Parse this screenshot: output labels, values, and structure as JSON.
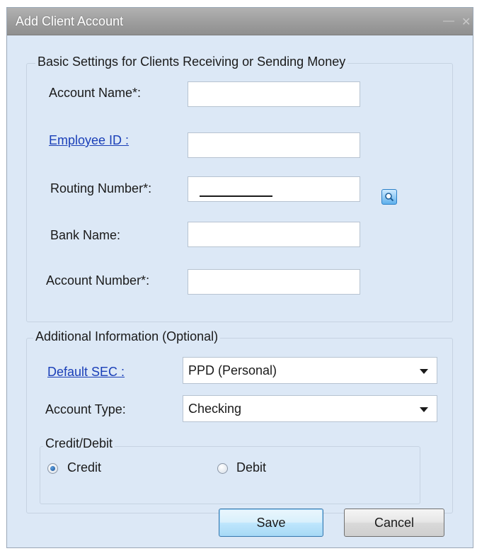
{
  "window": {
    "title": "Add Client Account",
    "minimize_glyph": "—",
    "close_glyph": "✕"
  },
  "basic_settings": {
    "legend": "Basic Settings for Clients Receiving or Sending Money",
    "account_name": {
      "label": "Account Name*:",
      "value": ""
    },
    "employee_id": {
      "label": "Employee ID :",
      "value": ""
    },
    "routing_number": {
      "label": "Routing Number*:",
      "value": ""
    },
    "bank_name": {
      "label": "Bank Name:",
      "value": ""
    },
    "account_number": {
      "label": "Account Number*:",
      "value": ""
    }
  },
  "additional_info": {
    "legend": "Additional Information (Optional)",
    "default_sec": {
      "label": "Default SEC :",
      "selected": "PPD (Personal)"
    },
    "account_type": {
      "label": "Account Type:",
      "selected": "Checking"
    },
    "credit_debit": {
      "legend": "Credit/Debit",
      "credit_label": "Credit",
      "debit_label": "Debit",
      "selected": "Credit"
    }
  },
  "buttons": {
    "save": "Save",
    "cancel": "Cancel"
  },
  "icons": {
    "lookup": "search-icon"
  },
  "colors": {
    "dialog_bg": "#dce8f6",
    "link": "#1a3fb8",
    "titlebar": "#9d9d9d"
  }
}
